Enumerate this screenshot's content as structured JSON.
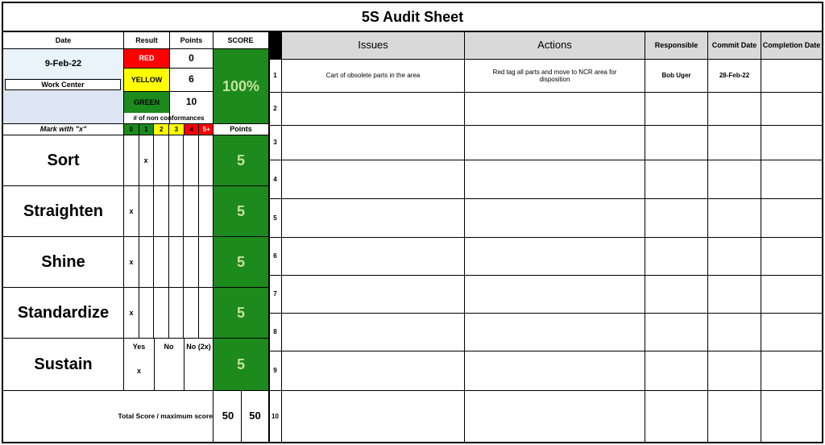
{
  "title": "5S Audit Sheet",
  "left": {
    "date_label": "Date",
    "date_value": "9-Feb-22",
    "work_center_label": "Work Center",
    "work_center_value": "",
    "result_label": "Result",
    "points_label": "Points",
    "score_label": "SCORE",
    "score_value": "100%",
    "levels": [
      {
        "name": "RED",
        "points": "0",
        "color": "#ff0000"
      },
      {
        "name": "YELLOW",
        "points": "6",
        "color": "#ffff00"
      },
      {
        "name": "GREEN",
        "points": "10",
        "color": "#1c8a1c"
      }
    ],
    "nonconf_label": "# of non conformances",
    "mark_label": "Mark with \"x\"",
    "col_headers": [
      {
        "label": "0",
        "color": "#1c8a1c"
      },
      {
        "label": "1",
        "color": "#1c8a1c"
      },
      {
        "label": "2",
        "color": "#ffff00"
      },
      {
        "label": "3",
        "color": "#ffff00"
      },
      {
        "label": "4",
        "color": "#ff0000"
      },
      {
        "label": "5+",
        "color": "#ff0000"
      }
    ],
    "points_header": "Points",
    "categories": [
      {
        "name": "Sort",
        "mark": "x",
        "points": "5"
      },
      {
        "name": "Straighten",
        "mark": "x",
        "points": "5"
      },
      {
        "name": "Shine",
        "mark": "x",
        "points": "5"
      },
      {
        "name": "Standardize",
        "mark": "x",
        "points": "5"
      },
      {
        "name": "Sustain",
        "mark": "x",
        "points": "5"
      }
    ],
    "sustain_headers": [
      "Yes",
      "No",
      "No (2x)"
    ],
    "total_label": "Total Score / maximum score",
    "total_score": "50",
    "max_score": "50"
  },
  "right": {
    "headers": {
      "issues": "Issues",
      "actions": "Actions",
      "responsible": "Responsible",
      "commit": "Commit Date",
      "completion": "Completion Date"
    },
    "rows": [
      {
        "num": "1",
        "issue": "Cart of obsolete parts in the area",
        "action": "Red tag all parts and move to NCR area for disposition",
        "responsible": "Bob Uger",
        "commit": "28-Feb-22",
        "completion": ""
      },
      {
        "num": "2",
        "issue": "",
        "action": "",
        "responsible": "",
        "commit": "",
        "completion": ""
      },
      {
        "num": "3",
        "issue": "",
        "action": "",
        "responsible": "",
        "commit": "",
        "completion": ""
      },
      {
        "num": "4",
        "issue": "",
        "action": "",
        "responsible": "",
        "commit": "",
        "completion": ""
      },
      {
        "num": "5",
        "issue": "",
        "action": "",
        "responsible": "",
        "commit": "",
        "completion": ""
      },
      {
        "num": "6",
        "issue": "",
        "action": "",
        "responsible": "",
        "commit": "",
        "completion": ""
      },
      {
        "num": "7",
        "issue": "",
        "action": "",
        "responsible": "",
        "commit": "",
        "completion": ""
      },
      {
        "num": "8",
        "issue": "",
        "action": "",
        "responsible": "",
        "commit": "",
        "completion": ""
      },
      {
        "num": "9",
        "issue": "",
        "action": "",
        "responsible": "",
        "commit": "",
        "completion": ""
      },
      {
        "num": "10",
        "issue": "",
        "action": "",
        "responsible": "",
        "commit": "",
        "completion": ""
      }
    ]
  }
}
